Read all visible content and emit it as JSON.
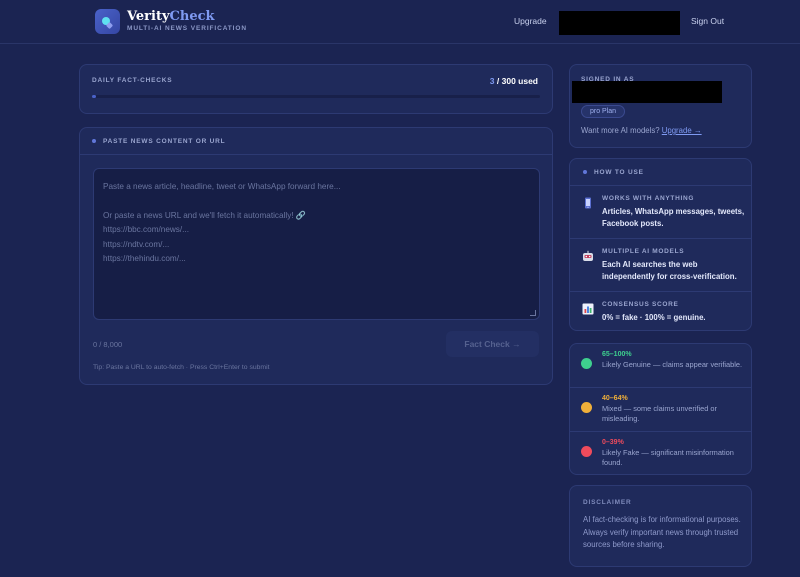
{
  "header": {
    "brand_part1": "Verity",
    "brand_part2": "Check",
    "brand_subtitle": "MULTI-AI NEWS VERIFICATION",
    "nav_upgrade": "Upgrade",
    "nav_signout": "Sign Out"
  },
  "daily": {
    "label": "DAILY FACT-CHECKS",
    "used": "3",
    "usage_suffix": " / 300 used",
    "progress_fraction": 0.01
  },
  "paste": {
    "label": "PASTE NEWS CONTENT OR URL",
    "placeholder_lines": [
      "Paste a news article, headline, tweet or WhatsApp forward here...",
      "",
      "Or paste a news URL and we'll fetch it automatically! 🔗",
      "https://bbc.com/news/...",
      "https://ndtv.com/...",
      "https://thehindu.com/..."
    ],
    "char_count": "0 / 8,000",
    "submit_label": "Fact Check →",
    "tip": "Tip: Paste a URL to auto-fetch · Press Ctrl+Enter to submit"
  },
  "account": {
    "signed_in_label": "SIGNED IN AS",
    "plan": "pro Plan",
    "more_models_text": "Want more AI models? ",
    "upgrade_link": "Upgrade →"
  },
  "howto": {
    "title": "HOW TO USE",
    "items": [
      {
        "icon": "phone-icon",
        "title": "WORKS WITH ANYTHING",
        "desc": "Articles, WhatsApp messages, tweets, Facebook posts."
      },
      {
        "icon": "robot-icon",
        "title": "MULTIPLE AI MODELS",
        "desc": "Each AI searches the web independently for cross-verification."
      },
      {
        "icon": "chart-icon",
        "title": "CONSENSUS SCORE",
        "desc": "0% = fake · 100% = genuine."
      }
    ]
  },
  "scores": [
    {
      "range": "65–100%",
      "desc": "Likely Genuine — claims appear verifiable.",
      "color": "#3ecf8e"
    },
    {
      "range": "40–64%",
      "desc": "Mixed — some claims unverified or misleading.",
      "color": "#f0b03a"
    },
    {
      "range": "0–39%",
      "desc": "Likely Fake — significant misinformation found.",
      "color": "#ef4b5c"
    }
  ],
  "disclaimer": {
    "title": "DISCLAIMER",
    "text": "AI fact-checking is for informational purposes. Always verify important news through trusted sources before sharing."
  },
  "colors": {
    "background": "#1b2452",
    "accent": "#7f9af2"
  }
}
